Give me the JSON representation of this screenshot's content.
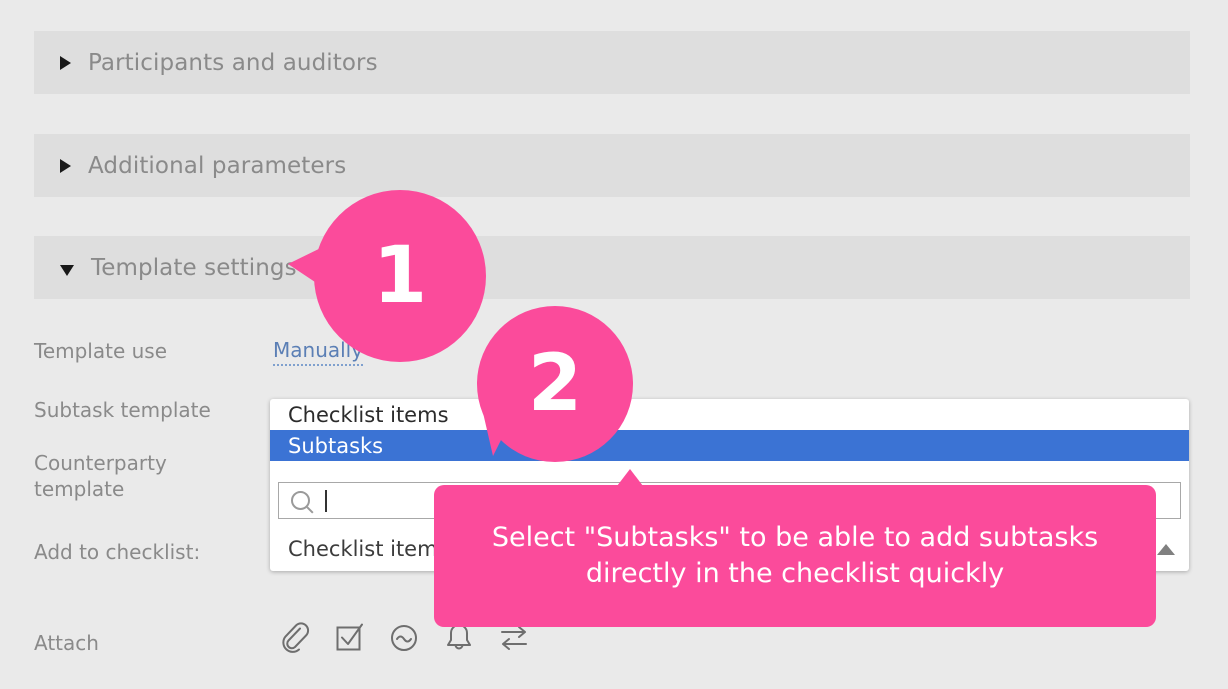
{
  "sections": [
    {
      "id": "participants",
      "label": "Participants and auditors",
      "expanded": false
    },
    {
      "id": "additional",
      "label": "Additional parameters",
      "expanded": false
    },
    {
      "id": "template",
      "label": "Template settings",
      "expanded": true
    }
  ],
  "form": {
    "template_use": {
      "label": "Template use",
      "value": "Manually"
    },
    "subtask_template": {
      "label": "Subtask template"
    },
    "counterparty_template": {
      "label": "Counterparty\ntemplate"
    },
    "counterparty_template_line1": "Counterparty",
    "counterparty_template_line2": "template",
    "add_to_checklist": {
      "label": "Add to checklist:"
    },
    "attach": {
      "label": "Attach"
    }
  },
  "dropdown": {
    "options": [
      {
        "label": "Checklist items",
        "selected": false
      },
      {
        "label": "Subtasks",
        "selected": true
      }
    ],
    "search": {
      "value": "",
      "placeholder": "",
      "icon": "search-icon"
    },
    "current_value": "Checklist items",
    "collapse_icon": "chevron-up-icon"
  },
  "attach_icons": [
    {
      "name": "paperclip-icon"
    },
    {
      "name": "checkbox-check-icon"
    },
    {
      "name": "circle-tilde-icon"
    },
    {
      "name": "bell-icon"
    },
    {
      "name": "swap-arrows-icon"
    }
  ],
  "annotations": {
    "badge_1": "1",
    "badge_2": "2",
    "tooltip": "Select \"Subtasks\" to be able to add subtasks directly in the checklist quickly"
  },
  "colors": {
    "accent_pink": "#fb4b9b",
    "highlight_blue": "#3b73d4",
    "link_blue": "#5b7fb5",
    "page_bg": "#eaeaea",
    "bar_bg": "#dedede",
    "label_gray": "#8a8a8a"
  }
}
